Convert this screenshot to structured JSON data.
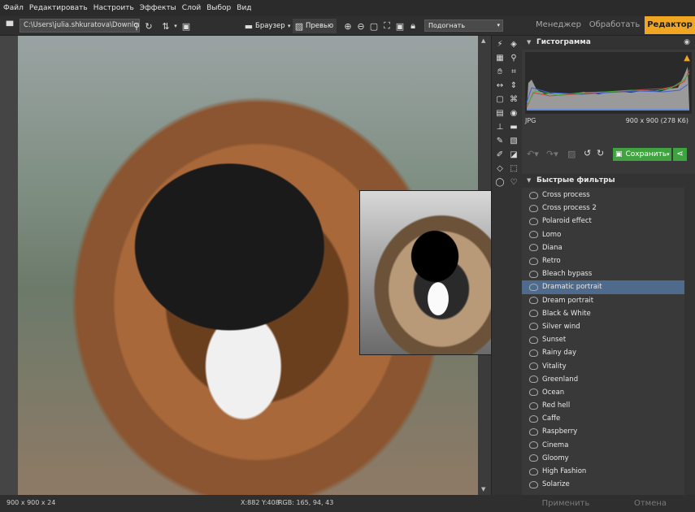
{
  "menu": [
    "Файл",
    "Редактировать",
    "Настроить",
    "Эффекты",
    "Слой",
    "Выбор",
    "Вид"
  ],
  "toolbar": {
    "path": "C:\\Users\\julia.shkuratova\\Downloads\\",
    "browser_label": "Браузер",
    "preview_label": "Превью",
    "zoom_mode": "Подогнать"
  },
  "modes": {
    "manager": "Менеджер",
    "process": "Обработать",
    "editor": "Редактор"
  },
  "histogram": {
    "title": "Гистограмма",
    "format": "JPG",
    "size": "900 x 900 (278 K6)",
    "warning_color": "#f0a622"
  },
  "actions": {
    "save_label": "Сохранить"
  },
  "filters": {
    "title": "Быстрые фильтры",
    "selected": "Dramatic portrait",
    "items": [
      "Cross process",
      "Cross process 2",
      "Polaroid effect",
      "Lomo",
      "Diana",
      "Retro",
      "Bleach bypass",
      "Dramatic portrait",
      "Dream portrait",
      "Black & White",
      "Silver wind",
      "Sunset",
      "Rainy day",
      "Vitality",
      "Greenland",
      "Ocean",
      "Red hell",
      "Caffe",
      "Raspberry",
      "Cinema",
      "Gloomy",
      "High Fashion",
      "Solarize"
    ]
  },
  "status": {
    "dims": "900 x 900 x 24",
    "coords": "X:882 Y:408",
    "rgb": "RGB: 165, 94, 43"
  },
  "bottom_buttons": {
    "apply": "Применить",
    "cancel": "Отмена"
  },
  "colors": {
    "accent": "#f0a622",
    "save_green": "#3fa33f",
    "selection": "#4e6a8c"
  }
}
